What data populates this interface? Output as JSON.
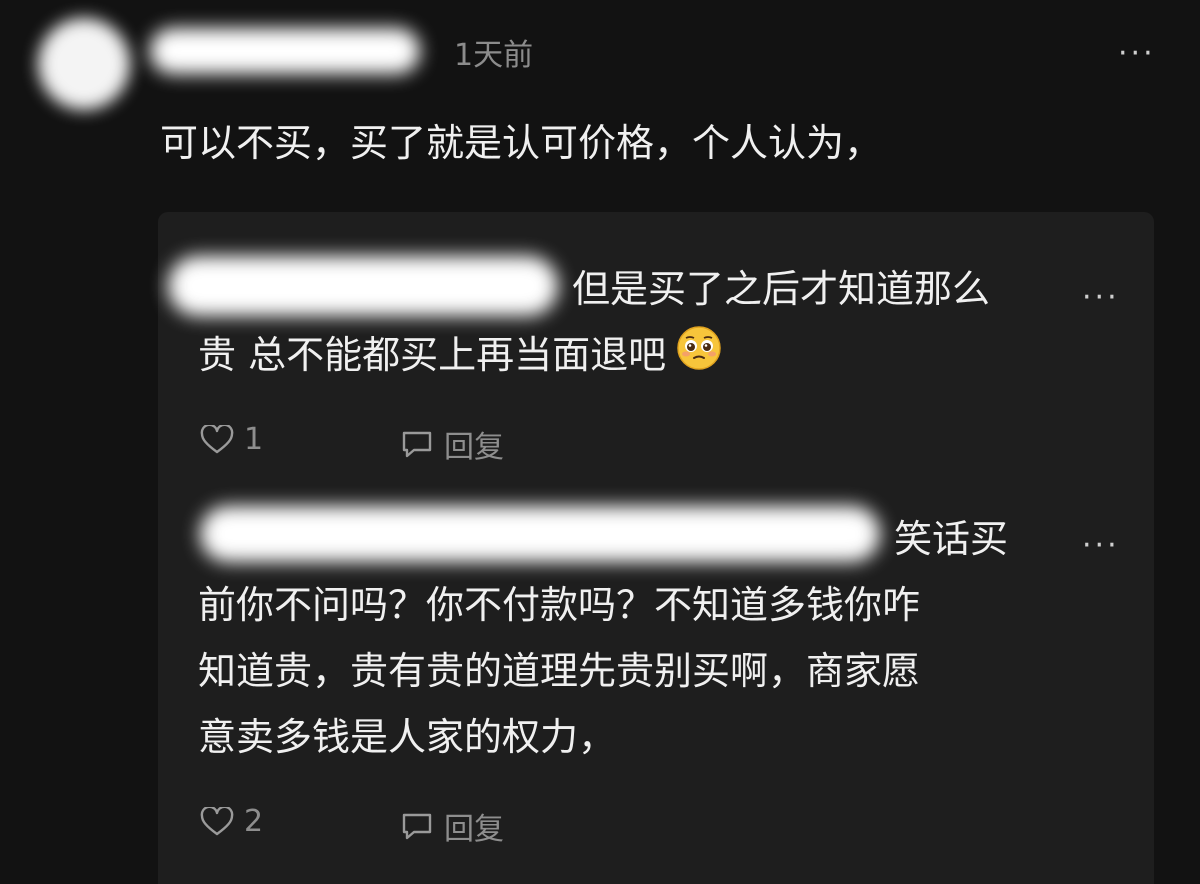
{
  "comment": {
    "timestamp": "1天前",
    "text": "可以不买，买了就是认可价格，个人认为，",
    "more_icon": "ellipsis-icon"
  },
  "replies": [
    {
      "line1": "但是买了之后才知道那么",
      "line2": "贵 总不能都买上再当面退吧",
      "emoji": "pleading-face-emoji",
      "likes": "1",
      "reply_label": "回复",
      "more_icon": "ellipsis-icon"
    },
    {
      "line1": "笑话买",
      "line2": "前你不问吗？你不付款吗？不知道多钱你咋",
      "line3": "知道贵，贵有贵的道理先贵别买啊，商家愿",
      "line4": "意卖多钱是人家的权力，",
      "likes": "2",
      "reply_label": "回复",
      "more_icon": "ellipsis-icon"
    }
  ],
  "colors": {
    "background": "#121212",
    "reply_background": "#1e1e1e",
    "muted_text": "#8c8c8c"
  }
}
